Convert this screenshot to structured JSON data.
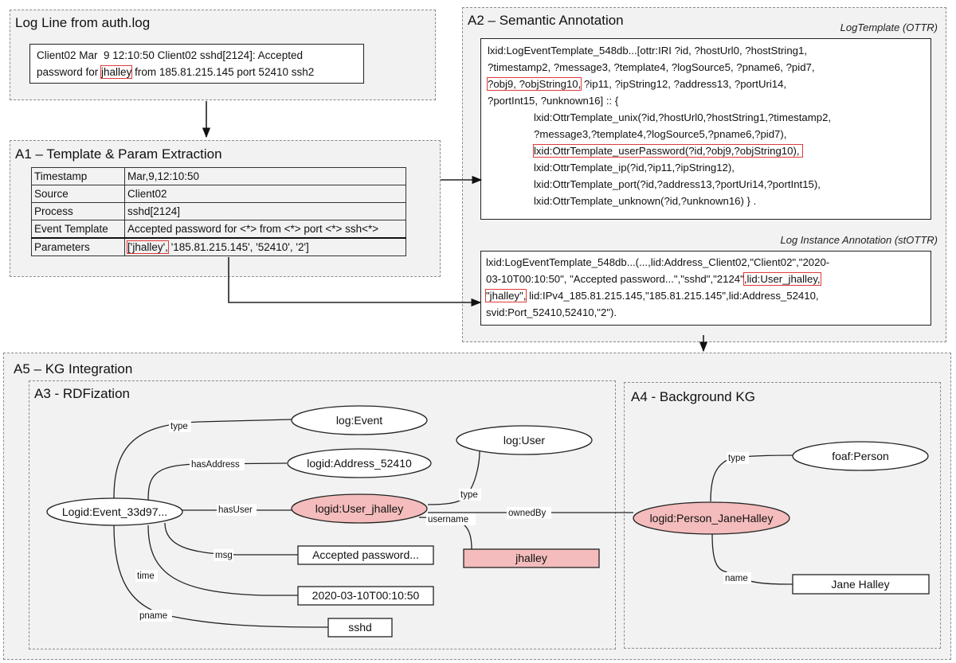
{
  "log_line": {
    "title": "Log Line from auth.log",
    "line1": "Client02 Mar  9 12:10:50 Client02 sshd[2124]: Accepted",
    "line2_pre": "password for ",
    "line2_highlight": "jhalley",
    "line2_post": " from 185.81.215.145 port 52410 ssh2"
  },
  "a1": {
    "title": "A1 – Template & Param Extraction",
    "rows": [
      {
        "key": "Timestamp",
        "value": "Mar,9,12:10:50"
      },
      {
        "key": "Source",
        "value": "Client02"
      },
      {
        "key": "Process",
        "value": "sshd[2124]"
      },
      {
        "key": "Event Template",
        "value": "Accepted password for <*> from <*> port <*> ssh<*>"
      }
    ],
    "params_key": "Parameters",
    "params_highlight": "['jhalley',",
    "params_rest": " '185.81.215.145', '52410', '2']"
  },
  "a2": {
    "title": "A2 – Semantic Annotation",
    "template_label": "LogTemplate (OTTR)",
    "template_lines": {
      "l1": "lxid:LogEventTemplate_548db...[ottr:IRI ?id, ?hostUrl0, ?hostString1,",
      "l2": "?timestamp2, ?message3, ?template4, ?logSource5, ?pname6, ?pid7,",
      "l3_highlight": "?obj9, ?objString10,",
      "l3_rest": " ?ip11, ?ipString12, ?address13, ?portUri14,",
      "l4": "?portInt15, ?unknown16] :: {",
      "l5": "lxid:OttrTemplate_unix(?id,?hostUrl0,?hostString1,?timestamp2,",
      "l6": "?message3,?template4,?logSource5,?pname6,?pid7),",
      "l7_highlight": "lxid:OttrTemplate_userPassword(?id,?obj9,?objString10),",
      "l8": "lxid:OttrTemplate_ip(?id,?ip11,?ipString12),",
      "l9": "lxid:OttrTemplate_port(?id,?address13,?portUri14,?portInt15),",
      "l10": "lxid:OttrTemplate_unknown(?id,?unknown16) } ."
    },
    "instance_label": "Log Instance Annotation (stOTTR)",
    "instance_lines": {
      "l1": "lxid:LogEventTemplate_548db...(...,lid:Address_Client02,\"Client02\",\"2020-",
      "l2_pre": "03-10T00:10:50\", \"Accepted password...\",\"sshd\",\"2124\"",
      "l2_highlight": ",lid:User_jhalley,",
      "l3_highlight": "\"jhalley\",",
      "l3_rest": " lid:IPv4_185.81.215.145,\"185.81.215.145\",lid:Address_52410,",
      "l4": "svid:Port_52410,52410,\"2\")."
    }
  },
  "a5": {
    "title": "A5 – KG Integration"
  },
  "a3": {
    "title": "A3 - RDFization",
    "nodes": {
      "event": "Logid:Event_33d97...",
      "log_event": "log:Event",
      "address": "logid:Address_52410",
      "user": "logid:User_jhalley",
      "log_user": "log:User",
      "msg": "Accepted password...",
      "username": "jhalley",
      "time": "2020-03-10T00:10:50",
      "pname": "sshd"
    },
    "edges": {
      "type": "type",
      "hasAddress": "hasAddress",
      "hasUser": "hasUser",
      "msg": "msg",
      "time": "time",
      "pname": "pname",
      "user_type": "type",
      "username": "username",
      "ownedBy": "ownedBy"
    }
  },
  "a4": {
    "title": "A4 - Background KG",
    "nodes": {
      "person": "logid:Person_JaneHalley",
      "foaf_person": "foaf:Person",
      "name": "Jane Halley"
    },
    "edges": {
      "type": "type",
      "name": "name"
    }
  },
  "colors": {
    "highlight_fill": "#f4bcbc",
    "highlight_border": "#e03a3a",
    "panel_bg": "#f2f2f2"
  }
}
